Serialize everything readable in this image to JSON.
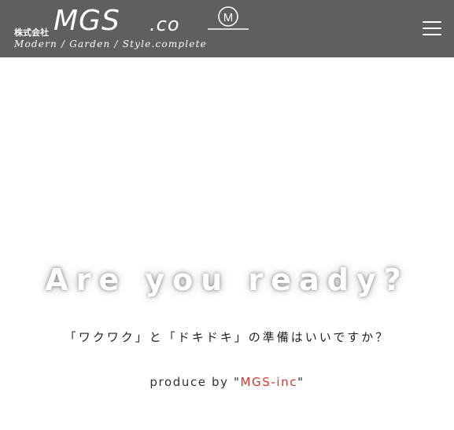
{
  "header": {
    "logo": {
      "company": "株式会社",
      "mark": "MGS",
      "suffix": ".co",
      "emblem_letter": "M",
      "tagline": "Modern / Garden / Style.complete"
    },
    "menu_icon": "hamburger-menu-icon",
    "background": "#5f5f5f"
  },
  "hero": {
    "headline": "Are you ready?",
    "subcopy": "「ワクワク」と「ドキドキ」の準備はいいですか？",
    "produce_prefix": "produce by \"",
    "produce_brand": "MGS-inc",
    "produce_suffix": "\"",
    "brand_color": "#d9342b"
  }
}
